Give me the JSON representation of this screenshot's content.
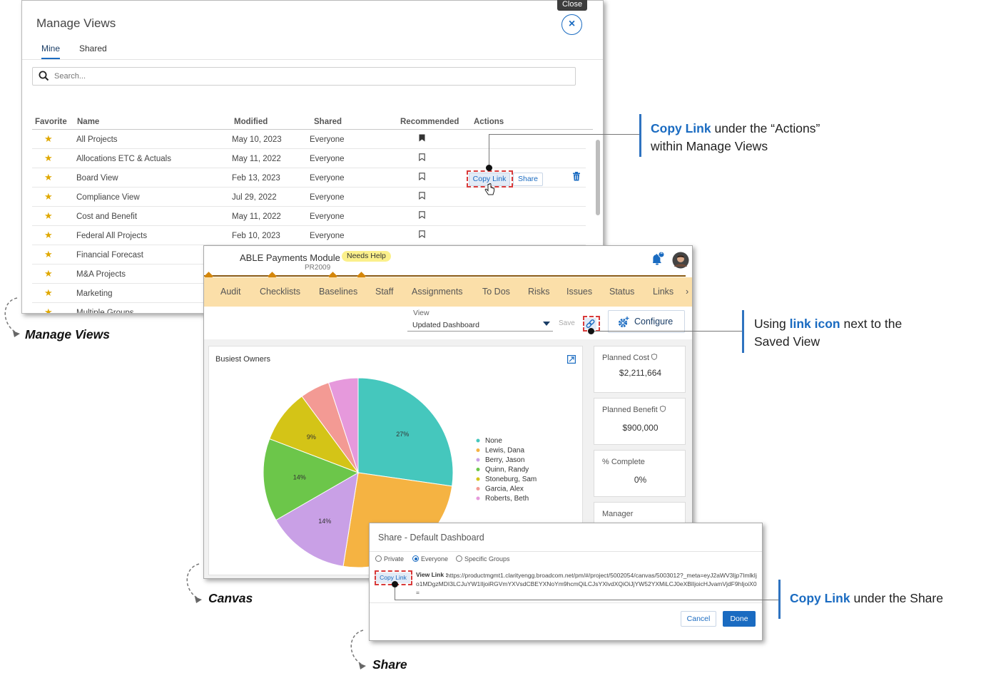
{
  "manage_views": {
    "title": "Manage Views",
    "close_tooltip": "Close",
    "close_symbol": "×",
    "tabs": [
      "Mine",
      "Shared"
    ],
    "search_placeholder": "Search...",
    "columns": [
      "Favorite",
      "Name",
      "Modified",
      "Shared",
      "Recommended",
      "Actions"
    ],
    "rows": [
      {
        "name": "All Projects",
        "modified": "May 10, 2023",
        "shared": "Everyone",
        "recommended": true
      },
      {
        "name": "Allocations ETC & Actuals",
        "modified": "May 11, 2022",
        "shared": "Everyone",
        "recommended": false
      },
      {
        "name": "Board View",
        "modified": "Feb 13, 2023",
        "shared": "Everyone",
        "recommended": false
      },
      {
        "name": "Compliance View",
        "modified": "Jul 29, 2022",
        "shared": "Everyone",
        "recommended": false
      },
      {
        "name": "Cost and Benefit",
        "modified": "May 11, 2022",
        "shared": "Everyone",
        "recommended": false
      },
      {
        "name": "Federal All Projects",
        "modified": "Feb 10, 2023",
        "shared": "Everyone",
        "recommended": false
      },
      {
        "name": "Financial Forecast",
        "modified": "",
        "shared": "",
        "recommended": false
      },
      {
        "name": "M&A Projects",
        "modified": "",
        "shared": "",
        "recommended": false
      },
      {
        "name": "Marketing",
        "modified": "",
        "shared": "",
        "recommended": false
      },
      {
        "name": "Multiple Groups",
        "modified": "",
        "shared": "",
        "recommended": false
      }
    ],
    "actions": {
      "copy_link": "Copy Link",
      "share": "Share"
    }
  },
  "canvas": {
    "project_title": "ABLE Payments Module",
    "project_id": "PR2009",
    "status_badge": "Needs Help",
    "notification_count": "2",
    "tabs": [
      "Audit",
      "Checklists",
      "Baselines",
      "Staff",
      "Assignments",
      "To Dos",
      "Risks",
      "Issues",
      "Status",
      "Links"
    ],
    "tabs_more": "›",
    "view_label": "View",
    "view_value": "Updated Dashboard",
    "save_label": "Save",
    "configure_label": "Configure",
    "widget_title": "Busiest Owners",
    "cards": [
      {
        "label": "Planned Cost",
        "value": "$2,211,664"
      },
      {
        "label": "Planned Benefit",
        "value": "$900,000"
      },
      {
        "label": "% Complete",
        "value": "0%"
      },
      {
        "label": "Manager",
        "value": ""
      }
    ]
  },
  "chart_data": {
    "type": "pie",
    "title": "Busiest Owners",
    "categories": [
      "None",
      "Lewis, Dana",
      "Berry, Jason",
      "Quinn, Randy",
      "Stoneburg, Sam",
      "Garcia, Alex",
      "Roberts, Beth"
    ],
    "values": [
      27,
      25,
      14,
      14,
      9,
      5,
      5
    ],
    "data_labels": [
      "27%",
      "",
      "14%",
      "14%",
      "9%",
      "",
      ""
    ],
    "colors": [
      "#45c7bd",
      "#f5b342",
      "#c9a0e6",
      "#6cc64a",
      "#d4c417",
      "#f39a94",
      "#e699dc"
    ],
    "legend_position": "right"
  },
  "share": {
    "title": "Share - Default Dashboard",
    "options": [
      "Private",
      "Everyone",
      "Specific Groups"
    ],
    "selected": "Everyone",
    "copy_link": "Copy Link",
    "view_link_label": "View Link :",
    "view_link_url": "https://productmgmt1.clarityengg.broadcom.net/pm/#/project/5002054/canvas/5003012?_meta=eyJ2aWV3Ijp7ImlkIjo1MDgzMDI3LCJuYW1lIjoiRGVmYXVsdCBEYXNoYm9hcmQiLCJsYXlvdXQiOiJjYW52YXMiLCJ0eXBlIjoicHJvamVjdF9hIjoiX0=",
    "cancel_label": "Cancel",
    "done_label": "Done"
  },
  "annotations": {
    "callout_1": {
      "bold": "Copy Link",
      "text": " under the “Actions”",
      "line2": "within Manage Views"
    },
    "callout_2": {
      "prefix": "Using ",
      "bold": "link icon",
      "text": " next to the",
      "line2": "Saved View"
    },
    "callout_3": {
      "bold": "Copy Link",
      "text": " under the Share"
    },
    "label_manage_views": "Manage Views",
    "label_canvas": "Canvas",
    "label_share": "Share"
  },
  "colors": {
    "accent": "#1a6bc1",
    "tab_bar": "#fbdfa9",
    "timeline": "#d4860b",
    "highlight": "#d83a3a",
    "badge": "#fbf08b"
  }
}
